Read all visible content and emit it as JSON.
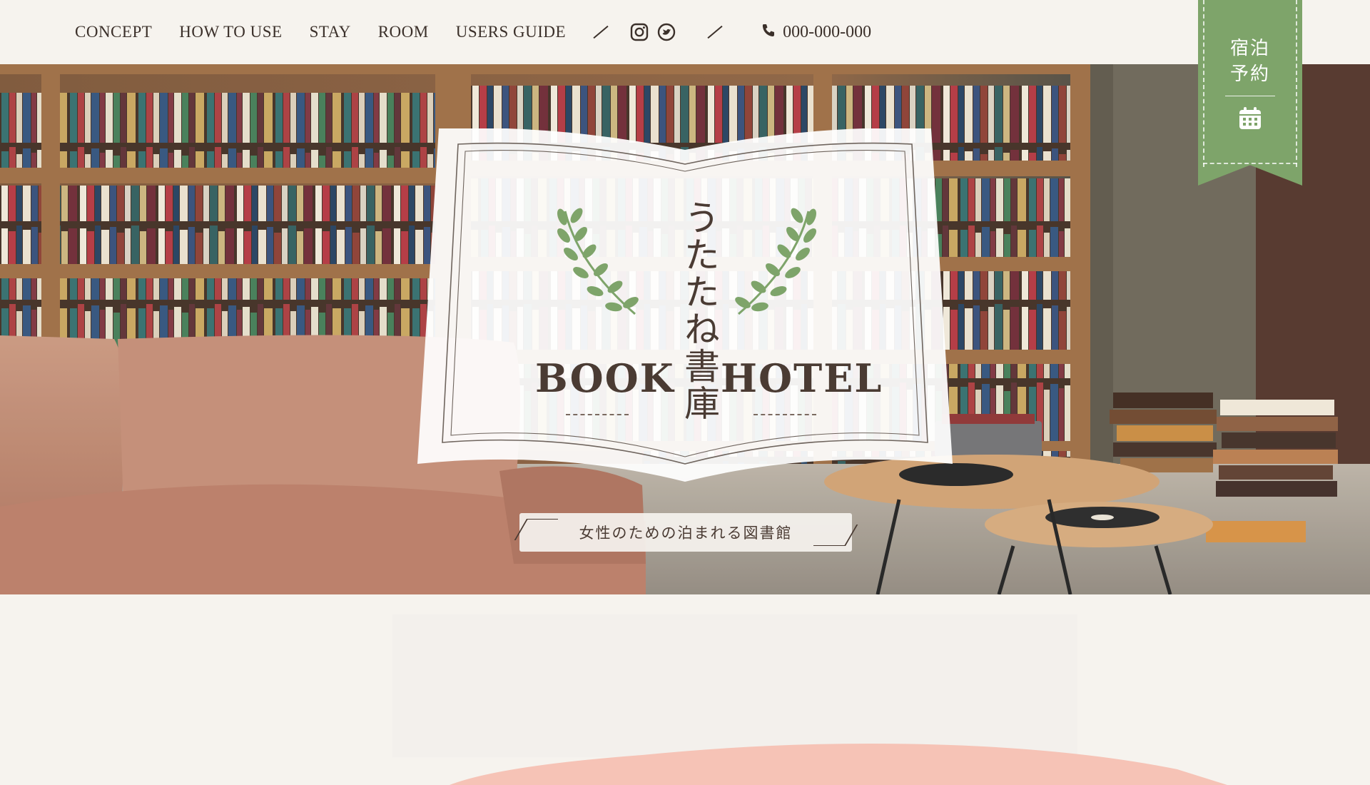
{
  "header": {
    "nav": [
      {
        "label": "CONCEPT"
      },
      {
        "label": "HOW TO USE"
      },
      {
        "label": "STAY"
      },
      {
        "label": "ROOM"
      },
      {
        "label": "USERS GUIDE"
      }
    ],
    "social_icons": [
      "instagram-icon",
      "twitter-icon"
    ],
    "phone": "000-000-000"
  },
  "reservation": {
    "label_line1": "宿泊",
    "label_line2": "予約",
    "icon": "calendar-icon"
  },
  "hero": {
    "logo": {
      "title_jp": "うたたね書庫",
      "word_left": "BOOK",
      "word_right": "HOTEL"
    },
    "tagline": "女性のための泊まれる図書館"
  },
  "colors": {
    "accent_green": "#7ea46a",
    "phone_highlight": "#f6c6bb",
    "text": "#3b302a",
    "background": "#f6f3ee",
    "brush_pink": "#f6c3b6"
  }
}
